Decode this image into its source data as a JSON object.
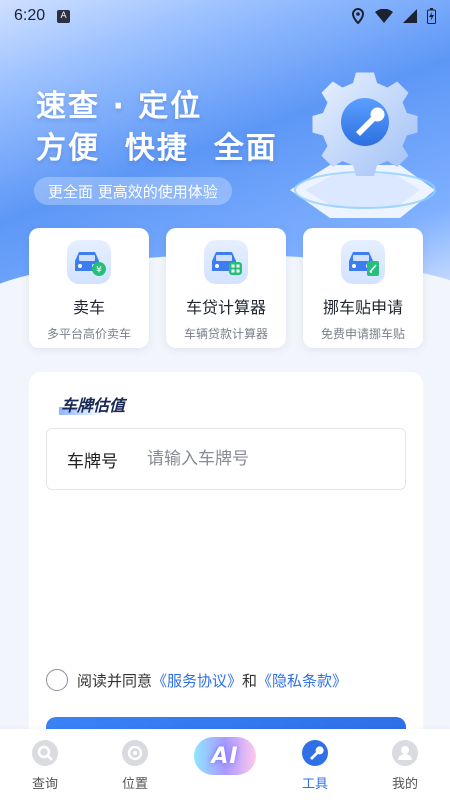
{
  "status_bar": {
    "time": "6:20",
    "notification_badge": "A"
  },
  "hero": {
    "headline_line1": "速查 · 定位",
    "headline_line2": "方便  快捷  全面",
    "subheadline": "更全面 更高效的使用体验"
  },
  "features": [
    {
      "title": "卖车",
      "subtitle": "多平台高价卖车",
      "icon": "car-yuan-icon"
    },
    {
      "title": "车贷计算器",
      "subtitle": "车辆贷款计算器",
      "icon": "car-calculator-icon"
    },
    {
      "title": "挪车贴申请",
      "subtitle": "免费申请挪车贴",
      "icon": "car-sticker-icon"
    }
  ],
  "form": {
    "title": "车牌估值",
    "plate_label": "车牌号",
    "plate_placeholder": "请输入车牌号",
    "plate_value": "",
    "agree_prefix": "阅读并同意",
    "service_link": "《服务协议》",
    "agree_and": "和",
    "privacy_link": "《隐私条款》"
  },
  "nav": [
    {
      "label": "查询",
      "icon": "search-icon",
      "active": false
    },
    {
      "label": "位置",
      "icon": "location-icon",
      "active": false
    },
    {
      "label": "AI",
      "icon": "ai-icon",
      "active": false
    },
    {
      "label": "工具",
      "icon": "wrench-icon",
      "active": true
    },
    {
      "label": "我的",
      "icon": "profile-icon",
      "active": false
    }
  ],
  "colors": {
    "accent": "#2f6fe8",
    "hero_blue": "#5d97f6",
    "background": "#f2f5fb"
  }
}
